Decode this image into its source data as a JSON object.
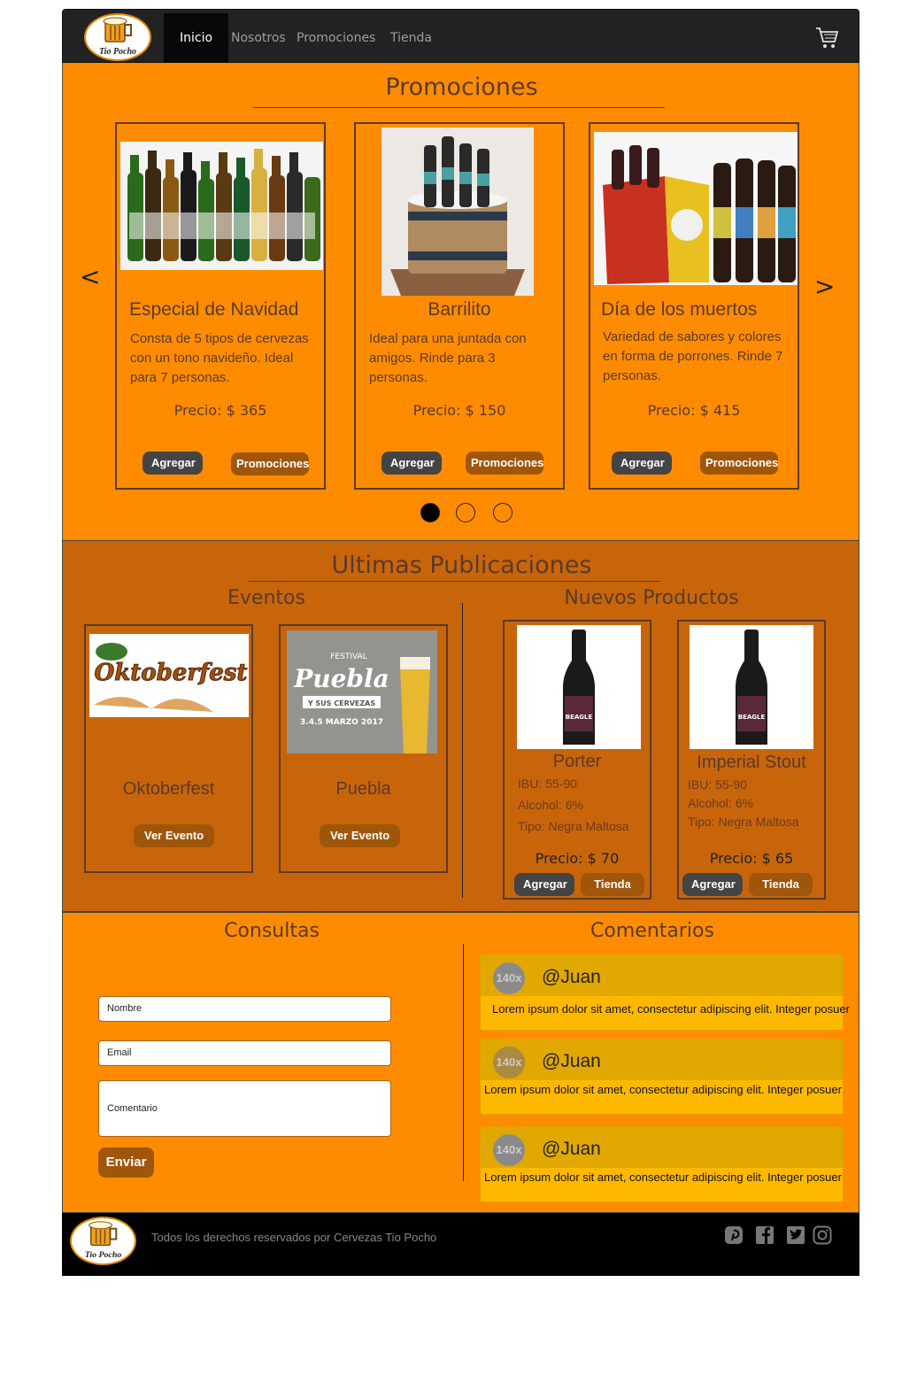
{
  "brand": {
    "logo_text": "Tio Pocho",
    "accent": "#ff8c00",
    "dark": "#222222"
  },
  "nav": {
    "items": [
      "Inicio",
      "Nosotros",
      "Promociones",
      "Tienda"
    ],
    "active": "Inicio",
    "cart_icon": "cart-icon"
  },
  "promociones": {
    "title": "Promociones",
    "prev": "<",
    "next": ">",
    "cards": [
      {
        "title": "Especial de Navidad",
        "desc": "Consta  de 5 tipos de cervezas con un tono navideño. Ideal para 7 personas.",
        "price": "Precio: $ 365",
        "add": "Agregar",
        "more": "Promociones"
      },
      {
        "title": "Barrilito",
        "desc": "Ideal para una juntada con amigos. Rinde para 3 personas.",
        "price": "Precio: $ 150",
        "add": "Agregar",
        "more": "Promociones"
      },
      {
        "title": "Día de los muertos",
        "desc": "Variedad de sabores y colores en forma de porrones. Rinde 7 personas.",
        "price": "Precio: $ 415",
        "add": "Agregar",
        "more": "Promociones"
      }
    ],
    "active_slide": 1,
    "slides": 3
  },
  "ultimas": {
    "title": "Ultimas Publicaciones",
    "eventos": {
      "title": "Eventos",
      "items": [
        {
          "title": "Oktoberfest",
          "button": "Ver Evento",
          "image_text": "Oktoberfest"
        },
        {
          "title": "Puebla",
          "button": "Ver Evento",
          "image_text": "Puebla",
          "image_sub": "Y SUS CERVEZAS",
          "image_top": "FESTIVAL",
          "image_date": "3.4.5 MARZO 2017"
        }
      ]
    },
    "productos": {
      "title": "Nuevos Productos",
      "items": [
        {
          "title": "Porter",
          "ibu": "IBU: 55-90",
          "alcohol": "Alcohol: 6%",
          "tipo": "Tipo: Negra Maltosa",
          "price": "Precio: $ 70",
          "add": "Agregar",
          "shop": "Tienda",
          "label": "BEAGLE"
        },
        {
          "title": "Imperial Stout",
          "ibu": "IBU: 55-90",
          "alcohol": "Alcohol: 6%",
          "tipo": "Tipo: Negra Maltosa",
          "price": "Precio: $ 65",
          "add": "Agregar",
          "shop": "Tienda",
          "label": "BEAGLE"
        }
      ]
    }
  },
  "consultas": {
    "title": "Consultas",
    "name_placeholder": "Nombre",
    "email_placeholder": "Email",
    "comment_placeholder": "Comentario",
    "send": "Enviar"
  },
  "comentarios": {
    "title": "Comentarios",
    "items": [
      {
        "avatar": "140x",
        "user": "@Juan",
        "text": "Lorem ipsum dolor sit amet, consectetur adipiscing elit. Integer posuer"
      },
      {
        "avatar": "140x",
        "user": "@Juan",
        "text": "Lorem ipsum dolor sit amet, consectetur adipiscing elit. Integer posuer"
      },
      {
        "avatar": "140x",
        "user": "@Juan",
        "text": "Lorem ipsum dolor sit amet, consectetur adipiscing elit. Integer posuer"
      }
    ]
  },
  "footer": {
    "text": "Todos los derechos reservados por Cervezas Tio Pocho",
    "social": [
      "pinterest-icon",
      "facebook-icon",
      "twitter-icon",
      "instagram-icon"
    ]
  }
}
